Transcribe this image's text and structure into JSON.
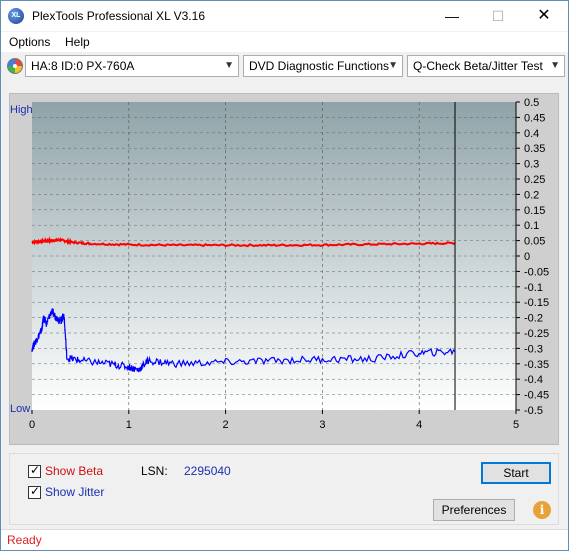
{
  "window": {
    "title": "PlexTools Professional XL V3.16",
    "icon": "XL"
  },
  "menu": {
    "options": "Options",
    "help": "Help"
  },
  "toolbar": {
    "drive": "HA:8 ID:0  PX-760A",
    "function": "DVD Diagnostic Functions",
    "test": "Q-Check Beta/Jitter Test"
  },
  "chart": {
    "left_high": "High",
    "left_low": "Low",
    "x_ticks": [
      "0",
      "1",
      "2",
      "3",
      "4",
      "5"
    ],
    "y_ticks": [
      "0.5",
      "0.45",
      "0.4",
      "0.35",
      "0.3",
      "0.25",
      "0.2",
      "0.15",
      "0.1",
      "0.05",
      "0",
      "-0.05",
      "-0.1",
      "-0.15",
      "-0.2",
      "-0.25",
      "-0.3",
      "-0.35",
      "-0.4",
      "-0.45",
      "-0.5"
    ],
    "colors": {
      "beta": "#ff0000",
      "jitter": "#0000ff",
      "cursor": "#000000"
    }
  },
  "chart_data": {
    "type": "line",
    "xlim": [
      0,
      5
    ],
    "ylim": [
      -0.5,
      0.5
    ],
    "grid": true,
    "cursor_x": 4.37,
    "series": [
      {
        "name": "Beta",
        "x": [
          0,
          0.1,
          0.2,
          0.3,
          0.4,
          0.6,
          1,
          1.5,
          2,
          2.5,
          3,
          3.5,
          4,
          4.37
        ],
        "values": [
          0.045,
          0.048,
          0.05,
          0.052,
          0.045,
          0.04,
          0.037,
          0.035,
          0.035,
          0.035,
          0.036,
          0.038,
          0.04,
          0.042
        ]
      },
      {
        "name": "Jitter",
        "x": [
          0,
          0.05,
          0.1,
          0.12,
          0.15,
          0.2,
          0.25,
          0.3,
          0.33,
          0.36,
          0.5,
          0.8,
          1.0,
          1.1,
          1.2,
          1.5,
          2,
          2.5,
          3,
          3.5,
          4,
          4.37
        ],
        "values": [
          -0.3,
          -0.27,
          -0.24,
          -0.2,
          -0.22,
          -0.18,
          -0.2,
          -0.21,
          -0.19,
          -0.33,
          -0.34,
          -0.35,
          -0.36,
          -0.37,
          -0.34,
          -0.35,
          -0.345,
          -0.34,
          -0.335,
          -0.335,
          -0.315,
          -0.31
        ]
      }
    ]
  },
  "controls": {
    "show_beta": "Show Beta",
    "show_jitter": "Show Jitter",
    "lsn_label": "LSN:",
    "lsn_value": "2295040",
    "start": "Start",
    "preferences": "Preferences"
  },
  "status": {
    "text": "Ready"
  }
}
